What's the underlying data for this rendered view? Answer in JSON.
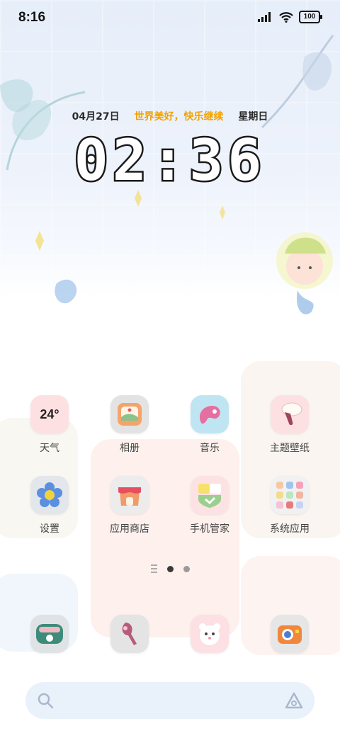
{
  "status_bar": {
    "time": "8:16",
    "battery": "100",
    "icons": [
      "signal-icon",
      "wifi-icon",
      "battery-icon"
    ]
  },
  "lock_widget": {
    "date": "04月27日",
    "slogan": "世界美好，快乐继续",
    "weekday": "星期日",
    "clock": "02:36"
  },
  "apps_row1": [
    {
      "label": "天气",
      "icon": "weather-icon",
      "temp": "24°"
    },
    {
      "label": "相册",
      "icon": "gallery-icon"
    },
    {
      "label": "音乐",
      "icon": "music-icon"
    },
    {
      "label": "主题壁纸",
      "icon": "themes-icon"
    }
  ],
  "apps_row2": [
    {
      "label": "设置",
      "icon": "settings-icon"
    },
    {
      "label": "应用商店",
      "icon": "app-store-icon"
    },
    {
      "label": "手机管家",
      "icon": "security-icon"
    },
    {
      "label": "系统应用",
      "icon": "system-apps-folder-icon"
    }
  ],
  "dock": [
    {
      "icon": "phone-icon"
    },
    {
      "icon": "messages-icon"
    },
    {
      "icon": "camera-icon"
    },
    {
      "icon": "browser-icon"
    }
  ],
  "page_indicator": {
    "pages": 2,
    "active": 1
  },
  "colors": {
    "slogan": "#f2a100",
    "clock_outline": "#1b1b1b",
    "search_bg": "#e9f1fb"
  }
}
